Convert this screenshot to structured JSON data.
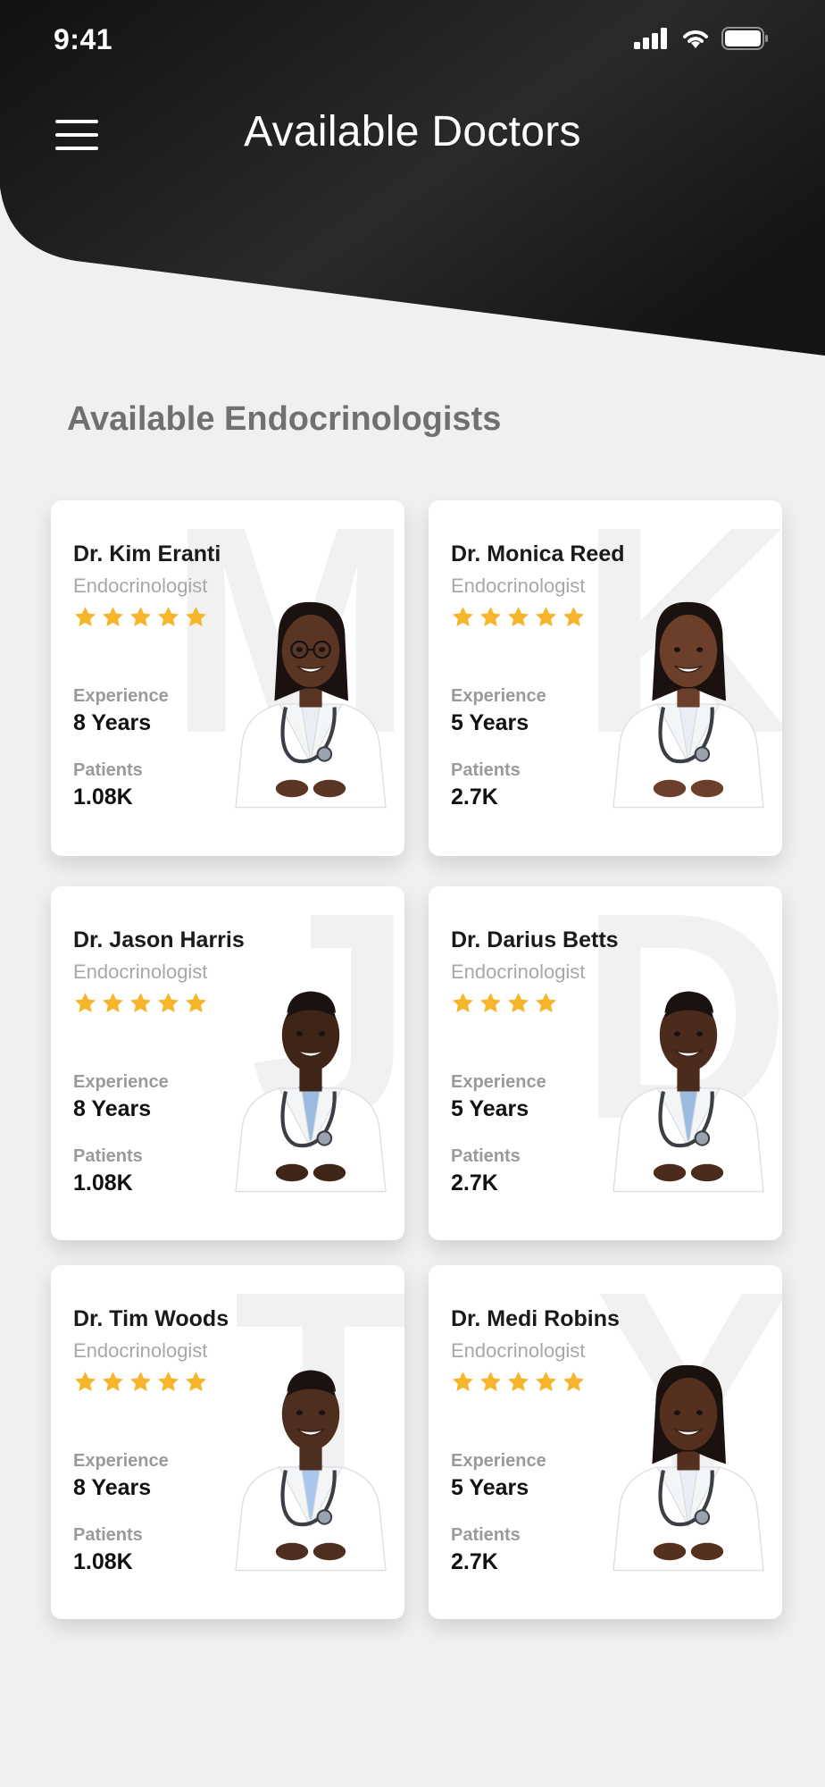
{
  "status_bar": {
    "time": "9:41"
  },
  "header": {
    "title": "Available Doctors"
  },
  "section": {
    "title": "Available Endocrinologists"
  },
  "colors": {
    "header": "#141414",
    "star": "#f7b52c",
    "background": "#f0f0f2"
  },
  "labels": {
    "experience": "Experience",
    "patients": "Patients"
  },
  "doctors": [
    {
      "name": "Dr. Kim Eranti",
      "specialty": "Endocrinologist",
      "rating": 5,
      "experience": "8 Years",
      "patients": "1.08K",
      "bg_letter": "M",
      "gender": "female",
      "coat": "#ffffff",
      "skin": "#5a3524"
    },
    {
      "name": "Dr. Monica Reed",
      "specialty": "Endocrinologist",
      "rating": 5,
      "experience": "5 Years",
      "patients": "2.7K",
      "bg_letter": "K",
      "gender": "female",
      "coat": "#ffffff",
      "skin": "#6b3f2a"
    },
    {
      "name": "Dr. Jason Harris",
      "specialty": "Endocrinologist",
      "rating": 5,
      "experience": "8 Years",
      "patients": "1.08K",
      "bg_letter": "J",
      "gender": "male",
      "coat": "#ffffff",
      "skin": "#3f2418"
    },
    {
      "name": "Dr. Darius Betts",
      "specialty": "Endocrinologist",
      "rating": 4,
      "experience": "5 Years",
      "patients": "2.7K",
      "bg_letter": "D",
      "gender": "male",
      "coat": "#ffffff",
      "skin": "#4a2b1c"
    },
    {
      "name": "Dr. Tim Woods",
      "specialty": "Endocrinologist",
      "rating": 5,
      "experience": "8 Years",
      "patients": "1.08K",
      "bg_letter": "T",
      "gender": "male",
      "coat": "#ffffff",
      "skin": "#4d2e1f"
    },
    {
      "name": "Dr. Medi Robins",
      "specialty": "Endocrinologist",
      "rating": 5,
      "experience": "5 Years",
      "patients": "2.7K",
      "bg_letter": "Y",
      "gender": "female",
      "coat": "#ffffff",
      "skin": "#55301f"
    }
  ]
}
